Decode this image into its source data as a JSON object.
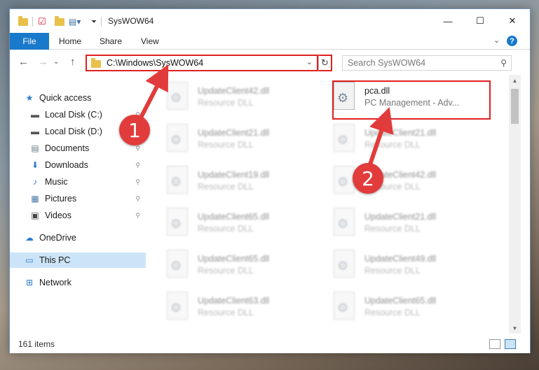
{
  "window": {
    "title": "SysWOW64",
    "controls": {
      "minimize": "—",
      "maximize": "☐",
      "close": "✕"
    }
  },
  "ribbon": {
    "tabs": [
      "File",
      "Home",
      "Share",
      "View"
    ],
    "collapse": "⌄",
    "help": "?"
  },
  "nav": {
    "back": "←",
    "forward": "→",
    "recent": "⌄",
    "up": "↑",
    "address": "C:\\Windows\\SysWOW64",
    "refresh": "↻",
    "search_placeholder": "Search SysWOW64"
  },
  "sidebar": {
    "items": [
      {
        "label": "Quick access",
        "icon": "star-icon",
        "glyph": "★",
        "color": "#2a7bd4"
      },
      {
        "label": "Local Disk (C:)",
        "icon": "drive-icon",
        "glyph": "▬",
        "color": "#555",
        "pinned": true
      },
      {
        "label": "Local Disk (D:)",
        "icon": "drive-icon",
        "glyph": "▬",
        "color": "#555",
        "pinned": false
      },
      {
        "label": "Documents",
        "icon": "documents-icon",
        "glyph": "▤",
        "color": "#6a7a8a",
        "pinned": true
      },
      {
        "label": "Downloads",
        "icon": "download-icon",
        "glyph": "⬇",
        "color": "#2a7bd4",
        "pinned": true
      },
      {
        "label": "Music",
        "icon": "music-icon",
        "glyph": "♪",
        "color": "#2a7bd4",
        "pinned": true
      },
      {
        "label": "Pictures",
        "icon": "pictures-icon",
        "glyph": "▦",
        "color": "#4a7aa8",
        "pinned": true
      },
      {
        "label": "Videos",
        "icon": "videos-icon",
        "glyph": "▣",
        "color": "#444",
        "pinned": true
      },
      {
        "label": "OneDrive",
        "icon": "cloud-icon",
        "glyph": "☁",
        "color": "#2a7bd4"
      },
      {
        "label": "This PC",
        "icon": "computer-icon",
        "glyph": "▭",
        "color": "#2a7bd4",
        "selected": true
      },
      {
        "label": "Network",
        "icon": "network-icon",
        "glyph": "⊞",
        "color": "#2a7bd4"
      }
    ],
    "pin_glyph": "📌"
  },
  "files": {
    "left": [
      {
        "name": "UpdateClient42.dll",
        "type": "Resource DLL"
      },
      {
        "name": "UpdateClient21.dll",
        "type": "Resource DLL"
      },
      {
        "name": "UpdateClient19.dll",
        "type": "Resource DLL"
      },
      {
        "name": "UpdateClient65.dll",
        "type": "Resource DLL"
      },
      {
        "name": "UpdateClient65.dll",
        "type": "Resource DLL"
      },
      {
        "name": "UpdateClient63.dll",
        "type": "Resource DLL"
      }
    ],
    "right": [
      {
        "name": "pca.dll",
        "type": "PC Management - Adv...",
        "highlighted": true
      },
      {
        "name": "UpdateClient21.dll",
        "type": "Resource DLL"
      },
      {
        "name": "UpdateClient42.dll",
        "type": "Resource DLL"
      },
      {
        "name": "UpdateClient21.dll",
        "type": "Resource DLL"
      },
      {
        "name": "UpdateClient49.dll",
        "type": "Resource DLL"
      },
      {
        "name": "UpdateClient65.dll",
        "type": "Resource DLL"
      }
    ]
  },
  "status": {
    "item_count": "161 items"
  },
  "callouts": {
    "first": "1",
    "second": "2"
  },
  "colors": {
    "accent": "#1979ca",
    "annotation": "#e02020",
    "selection": "#cce4f7"
  }
}
